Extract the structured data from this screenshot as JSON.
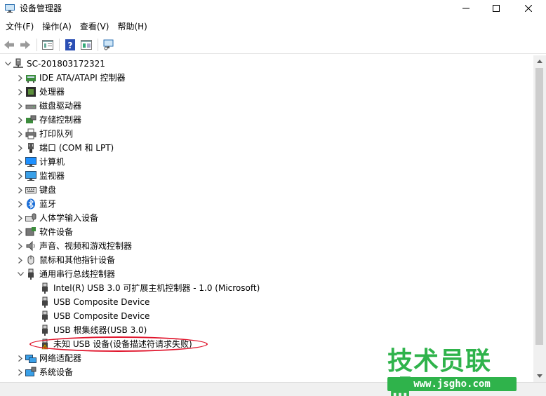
{
  "window": {
    "title": "设备管理器",
    "controls": {
      "minimize": "—",
      "maximize": "☐",
      "close": "✕"
    }
  },
  "menu": {
    "items": [
      "文件(F)",
      "操作(A)",
      "查看(V)",
      "帮助(H)"
    ]
  },
  "toolbar": {
    "icons": [
      "back-arrow-icon",
      "forward-arrow-icon",
      "properties-icon",
      "help-icon",
      "update-driver-icon",
      "scan-hardware-icon"
    ]
  },
  "tree": {
    "root": "SC-201803172321",
    "categories": [
      {
        "label": "IDE ATA/ATAPI 控制器",
        "icon": "ide-controller-icon",
        "expanded": false
      },
      {
        "label": "处理器",
        "icon": "processor-icon",
        "expanded": false
      },
      {
        "label": "磁盘驱动器",
        "icon": "disk-drive-icon",
        "expanded": false
      },
      {
        "label": "存储控制器",
        "icon": "storage-controller-icon",
        "expanded": false
      },
      {
        "label": "打印队列",
        "icon": "printer-icon",
        "expanded": false
      },
      {
        "label": "端口 (COM 和 LPT)",
        "icon": "port-icon",
        "expanded": false
      },
      {
        "label": "计算机",
        "icon": "computer-icon",
        "expanded": false
      },
      {
        "label": "监视器",
        "icon": "monitor-icon",
        "expanded": false
      },
      {
        "label": "键盘",
        "icon": "keyboard-icon",
        "expanded": false
      },
      {
        "label": "蓝牙",
        "icon": "bluetooth-icon",
        "expanded": false
      },
      {
        "label": "人体学输入设备",
        "icon": "hid-icon",
        "expanded": false
      },
      {
        "label": "软件设备",
        "icon": "software-device-icon",
        "expanded": false
      },
      {
        "label": "声音、视频和游戏控制器",
        "icon": "audio-icon",
        "expanded": false
      },
      {
        "label": "鼠标和其他指针设备",
        "icon": "mouse-icon",
        "expanded": false
      },
      {
        "label": "通用串行总线控制器",
        "icon": "usb-icon",
        "expanded": true
      }
    ],
    "usb_children": [
      {
        "label": "Intel(R) USB 3.0 可扩展主机控制器 - 1.0 (Microsoft)",
        "icon": "usb-icon",
        "warning": false
      },
      {
        "label": "USB Composite Device",
        "icon": "usb-icon",
        "warning": false
      },
      {
        "label": "USB Composite Device",
        "icon": "usb-icon",
        "warning": false
      },
      {
        "label": "USB 根集线器(USB 3.0)",
        "icon": "usb-icon",
        "warning": false
      },
      {
        "label": "未知 USB 设备(设备描述符请求失败)",
        "icon": "warning-icon",
        "warning": true
      }
    ],
    "after": [
      {
        "label": "网络适配器",
        "icon": "network-adapter-icon",
        "expanded": false
      },
      {
        "label": "系统设备",
        "icon": "system-device-icon",
        "expanded": false
      }
    ]
  },
  "watermark": {
    "brand": "技术员联盟",
    "url": "www.jsgho.com"
  },
  "colors": {
    "annotation": "#e0142b",
    "watermark": "#2fb34b"
  }
}
